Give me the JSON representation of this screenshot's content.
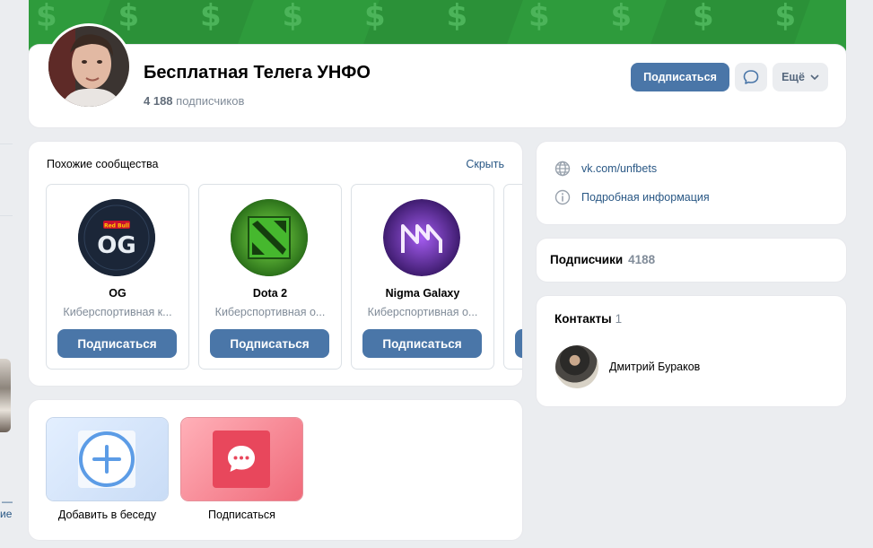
{
  "group": {
    "title": "Бесплатная Телега УНФО",
    "subs_count": "4 188",
    "subs_label": "подписчиков",
    "subscribe_label": "Подписаться",
    "more_label": "Ещё"
  },
  "cover": {
    "pattern": "$ $ $ $ $ $ $ $ $ $ $ $ $ $ $ $"
  },
  "similar": {
    "title": "Похожие сообщества",
    "hide_label": "Скрыть",
    "items": [
      {
        "name": "OG",
        "desc": "Киберспортивная к...",
        "button": "Подписаться"
      },
      {
        "name": "Dota 2",
        "desc": "Киберспортивная о...",
        "button": "Подписаться"
      },
      {
        "name": "Nigma Galaxy",
        "desc": "Киберспортивная о...",
        "button": "Подписаться"
      }
    ],
    "logo_text": {
      "og": "OG",
      "redbull": "Red Bull"
    }
  },
  "actions": {
    "add_to_chat": "Добавить в беседу",
    "subscribe": "Подписаться"
  },
  "info": {
    "link": "vk.com/unfbets",
    "details": "Подробная информация"
  },
  "subscribers": {
    "title": "Подписчики",
    "count": "4188"
  },
  "contacts": {
    "title": "Контакты",
    "count": "1",
    "person": "Дмитрий Бураков"
  },
  "left_fragment": {
    "text1": "—",
    "text2": "ие"
  },
  "colors": {
    "accent": "#4a76a8",
    "link": "#2a5885",
    "muted": "#818c99",
    "cover": "#2e9b3c"
  }
}
